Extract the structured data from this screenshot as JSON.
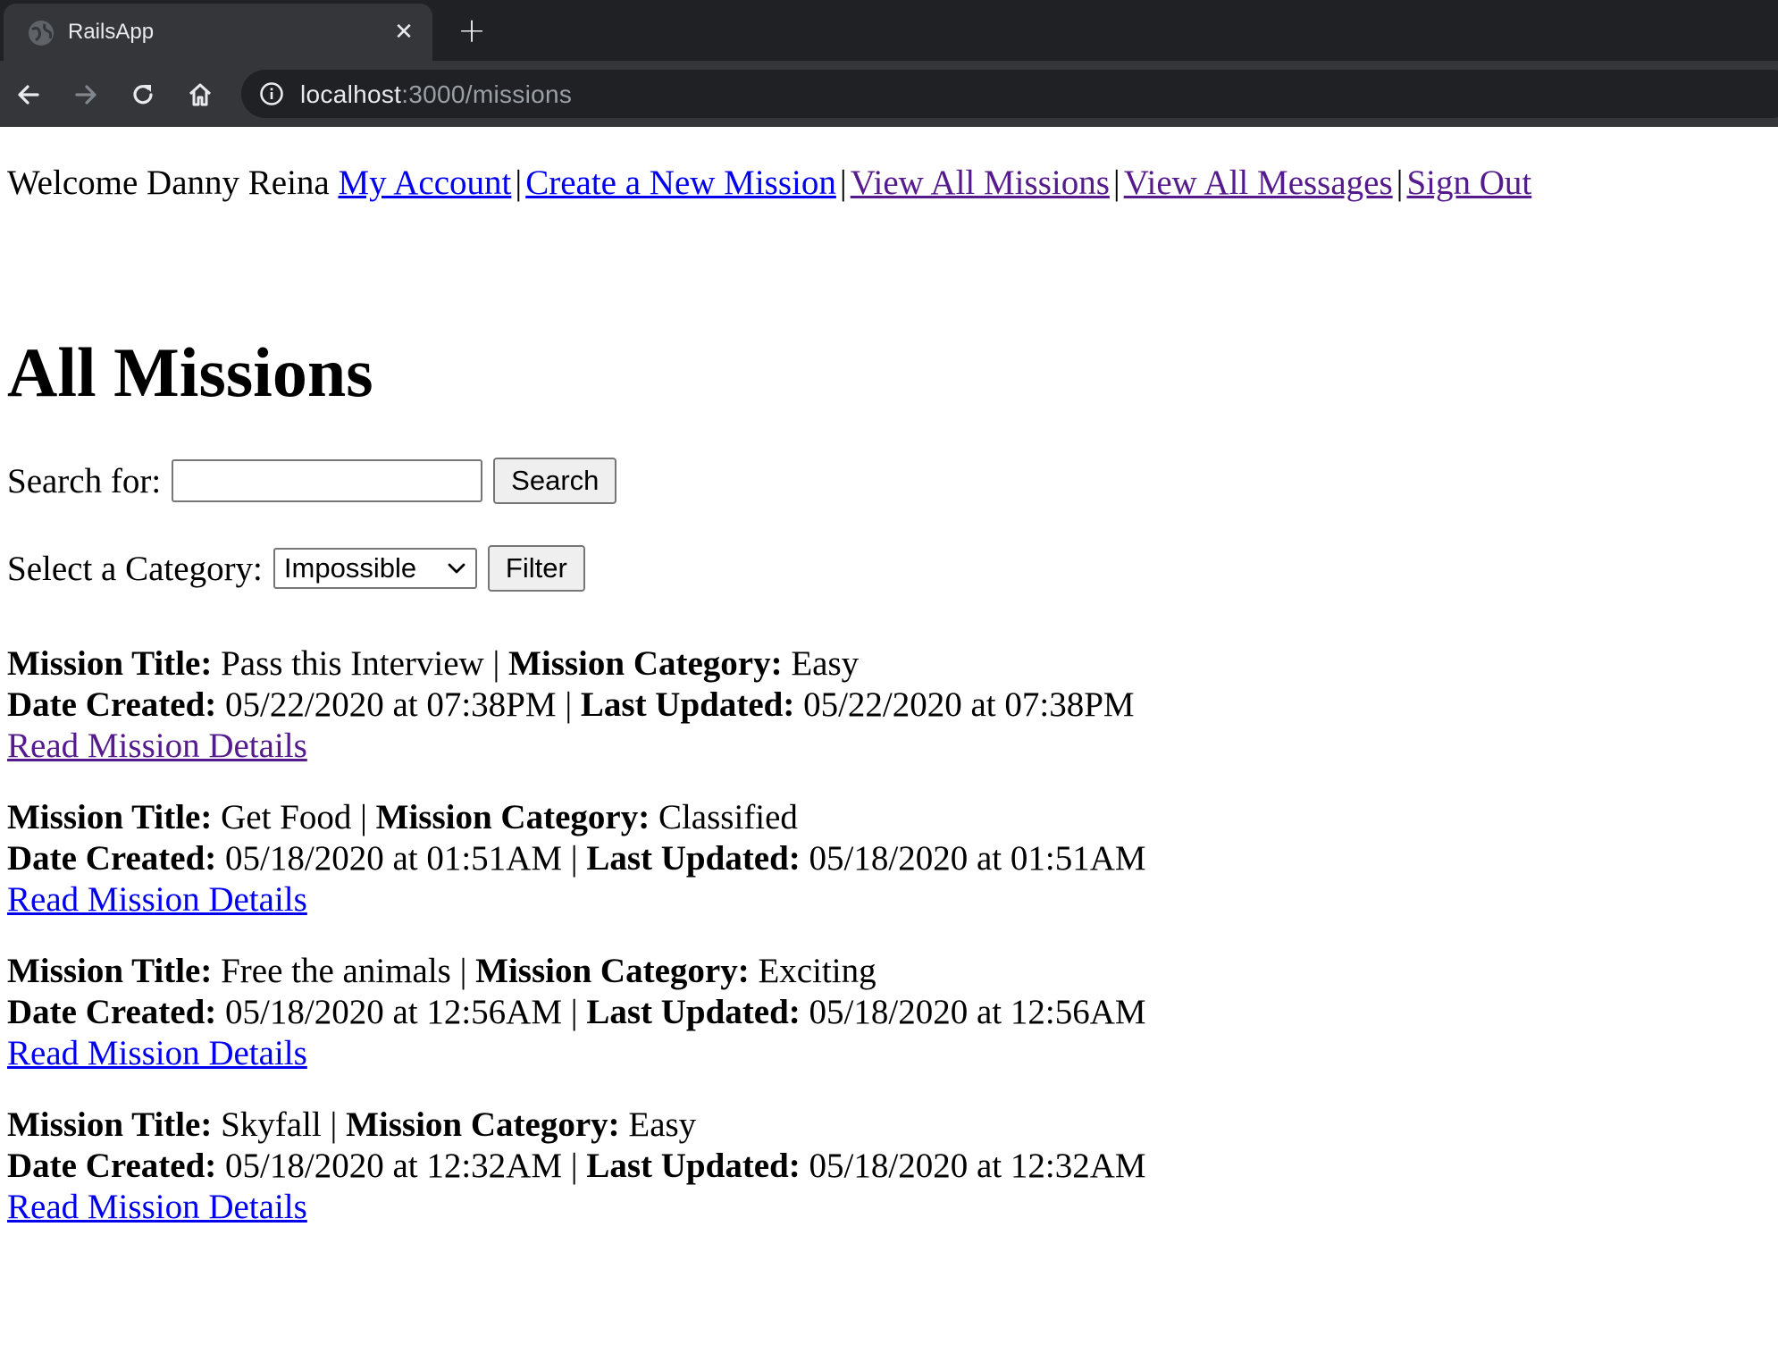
{
  "browser": {
    "tab_title": "RailsApp",
    "close_glyph": "✕",
    "new_tab_glyph": "+",
    "url_host": "localhost",
    "url_rest": ":3000/missions",
    "icons": [
      "globe-icon",
      "close-icon",
      "plus-icon",
      "back-arrow-icon",
      "forward-arrow-icon",
      "reload-icon",
      "home-icon",
      "info-icon"
    ]
  },
  "nav": {
    "welcome": "Welcome Danny Reina",
    "separator": "|",
    "links": [
      {
        "label": "My Account",
        "visited": false
      },
      {
        "label": "Create a New Mission",
        "visited": false
      },
      {
        "label": "View All Missions",
        "visited": true
      },
      {
        "label": "View All Messages",
        "visited": true
      },
      {
        "label": "Sign Out",
        "visited": true
      }
    ]
  },
  "page": {
    "title": "All Missions",
    "search_label": "Search for:",
    "search_value": "",
    "search_button": "Search",
    "category_label": "Select a Category:",
    "category_selected": "Impossible",
    "filter_button": "Filter"
  },
  "labels": {
    "title": "Mission Title:",
    "category": "Mission Category:",
    "created": "Date Created:",
    "updated": "Last Updated:",
    "pipe": "|",
    "details_link": "Read Mission Details"
  },
  "missions": [
    {
      "title": "Pass this Interview",
      "category": "Easy",
      "created": "05/22/2020 at 07:38PM",
      "updated": "05/22/2020 at 07:38PM",
      "link_visited": true
    },
    {
      "title": "Get Food",
      "category": "Classified",
      "created": "05/18/2020 at 01:51AM",
      "updated": "05/18/2020 at 01:51AM",
      "link_visited": false
    },
    {
      "title": "Free the animals",
      "category": "Exciting",
      "created": "05/18/2020 at 12:56AM",
      "updated": "05/18/2020 at 12:56AM",
      "link_visited": false
    },
    {
      "title": "Skyfall",
      "category": "Easy",
      "created": "05/18/2020 at 12:32AM",
      "updated": "05/18/2020 at 12:32AM",
      "link_visited": false
    }
  ],
  "colors": {
    "link": "#0000ee",
    "visited_link": "#551a8b",
    "chrome_dark": "#202124",
    "chrome_toolbar": "#35363a"
  }
}
